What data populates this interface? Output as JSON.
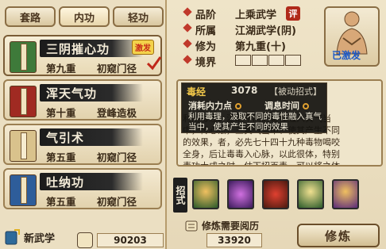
{
  "tabs": [
    "套路",
    "内功",
    "轻功"
  ],
  "skills": [
    {
      "name": "三阴摧心功",
      "level": "第九重",
      "rank": "初窥门径",
      "badge": "激发",
      "selected": true
    },
    {
      "name": "浑天气功",
      "level": "第十重",
      "rank": "登峰造极"
    },
    {
      "name": "气引术",
      "level": "第五重",
      "rank": "初窥门径"
    },
    {
      "name": "吐纳功",
      "level": "第五重",
      "rank": "初窥门径"
    }
  ],
  "info": {
    "grade_label": "品阶",
    "grade_value": "上乘武学",
    "grade_badge": "评",
    "sect_label": "所属",
    "sect_value": "江湖武学(阴)",
    "cultivation_label": "修为",
    "cultivation_value": "第九重(十)",
    "realm_label": "境界"
  },
  "portrait_status": "已激发",
  "popup": {
    "title": "毒经",
    "number": "3078",
    "type": "【被动招式】",
    "cost_label": "消耗内力点",
    "cast_label": "调息时间",
    "desc": "利用毒理，汲取不同的毒性融入真气当中，使其产生不同的效果"
  },
  "bg_text": "利用毒理、汲取不同的毒性融入真气当中，传心法，三真气当中、使其产生不同的效果，者，必先七十四十九种毒物喝咬全身，后让毒毒入心脉，以此很体，特别毒功大成之时，仗下招百毒，可以将之体修习此法有锦上",
  "moves_label": "招式",
  "cost_label": "修炼需要阅历",
  "new_skill_label": "新武学",
  "exp_current": "90203",
  "exp_needed": "33920",
  "train_button": "修炼",
  "colors": {
    "accent": "#c0392b",
    "ink": "#3a2a18",
    "activated": "#1a58c8"
  }
}
